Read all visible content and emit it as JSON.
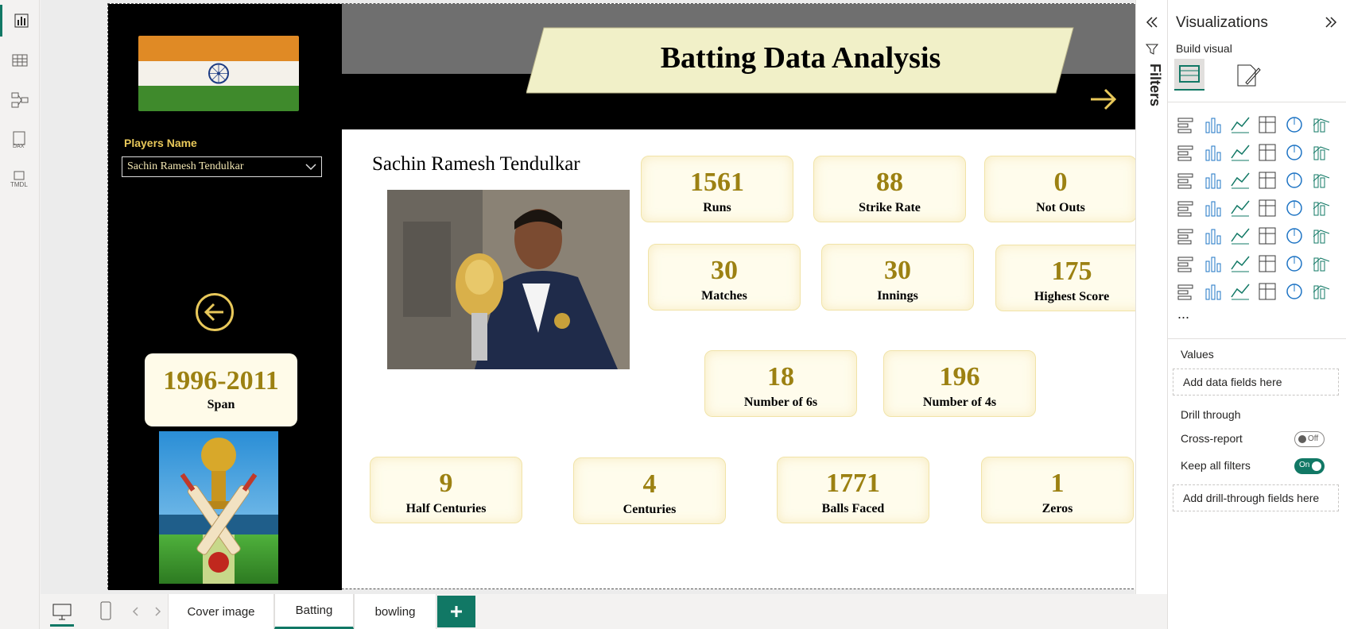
{
  "report": {
    "banner_title": "Batting Data Analysis",
    "players_label": "Players Name",
    "selected_player": "Sachin Ramesh Tendulkar",
    "player_heading": "Sachin Ramesh Tendulkar",
    "span": {
      "value": "1996-2011",
      "label": "Span"
    },
    "stats": [
      {
        "value": "1561",
        "label": "Runs"
      },
      {
        "value": "88",
        "label": "Strike Rate"
      },
      {
        "value": "0",
        "label": "Not Outs"
      },
      {
        "value": "30",
        "label": "Matches"
      },
      {
        "value": "30",
        "label": "Innings"
      },
      {
        "value": "175",
        "label": "Highest Score"
      },
      {
        "value": "18",
        "label": "Number of 6s"
      },
      {
        "value": "196",
        "label": "Number of 4s"
      },
      {
        "value": "9",
        "label": "Half Centuries"
      },
      {
        "value": "4",
        "label": "Centuries"
      },
      {
        "value": "1771",
        "label": "Balls Faced"
      },
      {
        "value": "1",
        "label": "Zeros"
      }
    ]
  },
  "filters_pane": {
    "label": "Filters"
  },
  "viz_pane": {
    "title": "Visualizations",
    "build_visual": "Build visual",
    "more": "...",
    "values_section": "Values",
    "values_well": "Add data fields here",
    "drill_through": "Drill through",
    "cross_report": "Cross-report",
    "cross_report_state": "Off",
    "keep_filters": "Keep all filters",
    "keep_filters_state": "On",
    "drill_well": "Add drill-through fields here"
  },
  "tabs": [
    {
      "label": "Cover image"
    },
    {
      "label": "Batting"
    },
    {
      "label": "bowling"
    }
  ],
  "rail_icons": [
    "report-view-icon",
    "table-view-icon",
    "model-view-icon",
    "dax-query-icon",
    "tmdl-view-icon"
  ],
  "colors": {
    "accent": "#117865",
    "gold": "#9c8112",
    "card_bg": "#fffcec",
    "banner_box": "#f1f0c8"
  }
}
